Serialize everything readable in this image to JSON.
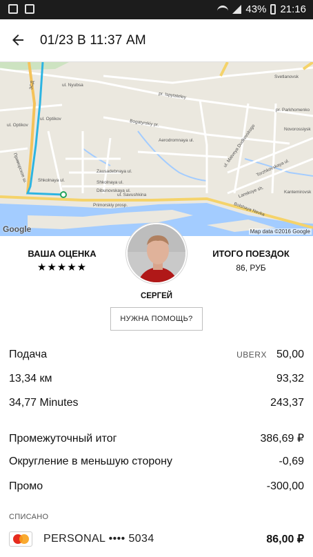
{
  "status_bar": {
    "battery": "43%",
    "time": "21:16"
  },
  "app_bar": {
    "title": "01/23 В 11:37 AM"
  },
  "map": {
    "labels": {
      "zsd": "ЗСД",
      "nyubsa": "ul. Nyubsa",
      "spytateley": "pr. Ispytateley",
      "svetlanovskoe": "Svetlanovsk",
      "optikov1": "ul. Optikov",
      "optikov2": "ul. Optikov",
      "bogatyrskiy": "Bogatyrskiy pr.",
      "aerodromnaya": "Aerodromnaya ul.",
      "parkhomenko": "pr. Parkhomenko",
      "novorossiyskaya": "Novorossiysk",
      "matveya": "ul. Matveya Dudkovskogo",
      "torzhkovskaya": "Torzhkovskaya ul.",
      "savushkina": "ul. Savushkina",
      "shkolnaya1": "Shkolnaya ul.",
      "shkolnaya2": "Shkolnaya ul.",
      "zausadebnaya": "Zausadebnaya ul.",
      "dibunovskaya": "Dibunovskaya ul.",
      "primorskiy": "Primorskiy prosp.",
      "bolshaya": "Bolshaya Nevka",
      "lanskoye": "Lanskoye sh.",
      "kantemirovskaya": "Kantemirovsk",
      "primorskoe": "Приморское ш."
    },
    "google": "Google",
    "attribution": "Map data ©2016 Google"
  },
  "rating": {
    "label": "ВАША ОЦЕНКА",
    "stars": "★★★★★"
  },
  "driver": {
    "name": "СЕРГЕЙ"
  },
  "trip_total": {
    "label": "ИТОГО ПОЕЗДОК",
    "value": "86, РУБ"
  },
  "help_button": "НУЖНА ПОМОЩЬ?",
  "fare": {
    "base": {
      "label": "Подача",
      "tag": "UBERX",
      "value": "50,00"
    },
    "distance": {
      "label": "13,34 км",
      "value": "93,32"
    },
    "time": {
      "label": "34,77 Minutes",
      "value": "243,37"
    },
    "subtotal": {
      "label": "Промежуточный итог",
      "value": "386,69 ₽"
    },
    "rounding": {
      "label": "Округление в меньшую сторону",
      "value": "-0,69"
    },
    "promo": {
      "label": "Промо",
      "value": "-300,00"
    }
  },
  "payment": {
    "charged_label": "СПИСАНО",
    "card_label": "PERSONAL •••• 5034",
    "amount": "86,00 ₽"
  }
}
